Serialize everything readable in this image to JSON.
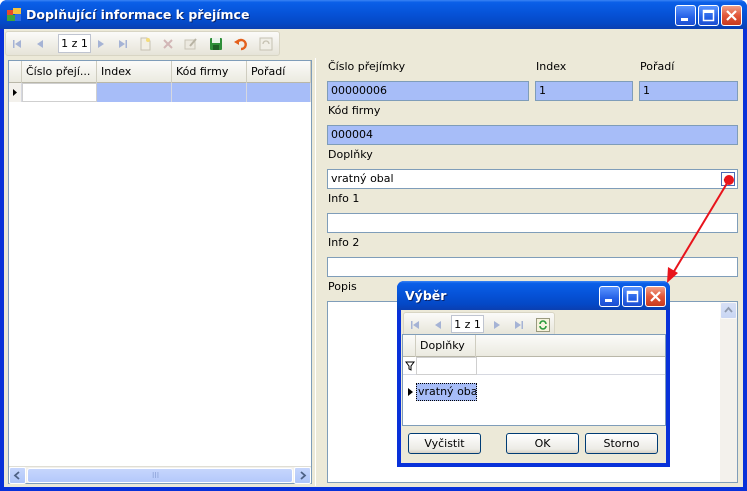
{
  "window": {
    "title": "Doplňující informace k přejímce"
  },
  "toolbar": {
    "position": "1 z 1"
  },
  "grid": {
    "columns": [
      "Číslo přejí...",
      "Index",
      "Kód firmy",
      "Pořadí"
    ],
    "scroll_thumb": "III"
  },
  "form": {
    "cislo_label": "Číslo přejímky",
    "cislo_value": "00000006",
    "index_label": "Index",
    "index_value": "1",
    "poradi_label": "Pořadí",
    "poradi_value": "1",
    "kod_label": "Kód firmy",
    "kod_value": "000004",
    "doplnky_label": "Doplňky",
    "doplnky_value": "vratný obal",
    "info1_label": "Info 1",
    "info1_value": "",
    "info2_label": "Info 2",
    "info2_value": "",
    "popis_label": "Popis",
    "popis_value": ""
  },
  "dialog": {
    "title": "Výběr",
    "position": "1 z 1",
    "column": "Doplňky",
    "row_value": "vratný obal",
    "clear_label": "Vyčistit",
    "ok_label": "OK",
    "cancel_label": "Storno"
  },
  "colors": {
    "titlebar": "#0653d8",
    "readonly_field": "#a7bdf8",
    "arrow": "#e8141c"
  }
}
